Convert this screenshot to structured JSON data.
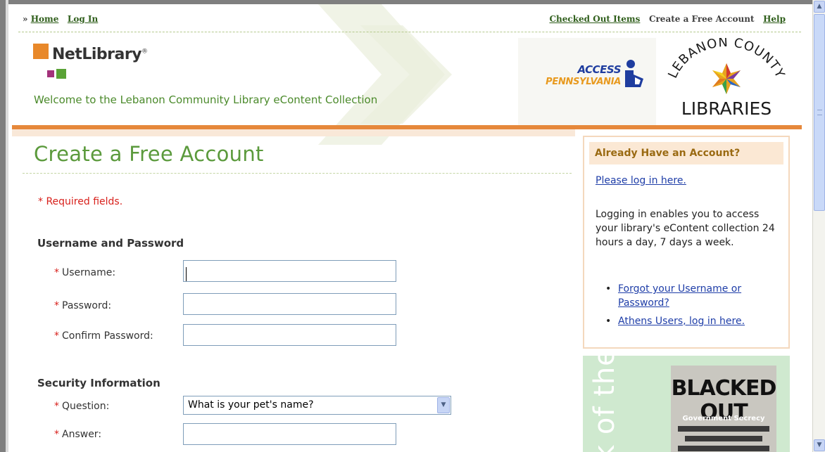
{
  "nav": {
    "prefix": "»",
    "home": "Home",
    "login": "Log In",
    "checked_out": "Checked Out Items",
    "create_account": "Create a Free Account",
    "help": "Help"
  },
  "header": {
    "brand": "NetLibrary",
    "trademark": "®",
    "welcome": "Welcome to the Lebanon Community Library eContent Collection",
    "access_line1": "ACCESS",
    "access_line2": "PENNSYLVANIA",
    "lebanon_arc": "LEBANON COUNTY",
    "lebanon_sub": "LIBRARIES"
  },
  "main": {
    "title": "Create a Free Account",
    "required_note": "* Required fields.",
    "section_user": "Username and Password",
    "section_security": "Security Information",
    "fields": {
      "username": "Username:",
      "password": "Password:",
      "confirm": "Confirm Password:",
      "question": "Question:",
      "answer": "Answer:"
    },
    "question_selected": "What is your pet's name?"
  },
  "sidebar": {
    "heading": "Already Have an Account?",
    "login_link": "Please log in here.",
    "description": "Logging in enables you to access your library's eContent collection 24 hours a day, 7 days a week.",
    "links": [
      "Forgot your Username or Password?",
      "Athens Users, log in here."
    ],
    "promo_vertical": "k of the NTH",
    "book_title": "BLACKED OUT",
    "book_subtitle": "Government Secrecy"
  },
  "colors": {
    "brand_green": "#5b9a3c",
    "accent_orange": "#e6883b",
    "required_red": "#d8211c",
    "link_blue": "#1f3ea8"
  }
}
